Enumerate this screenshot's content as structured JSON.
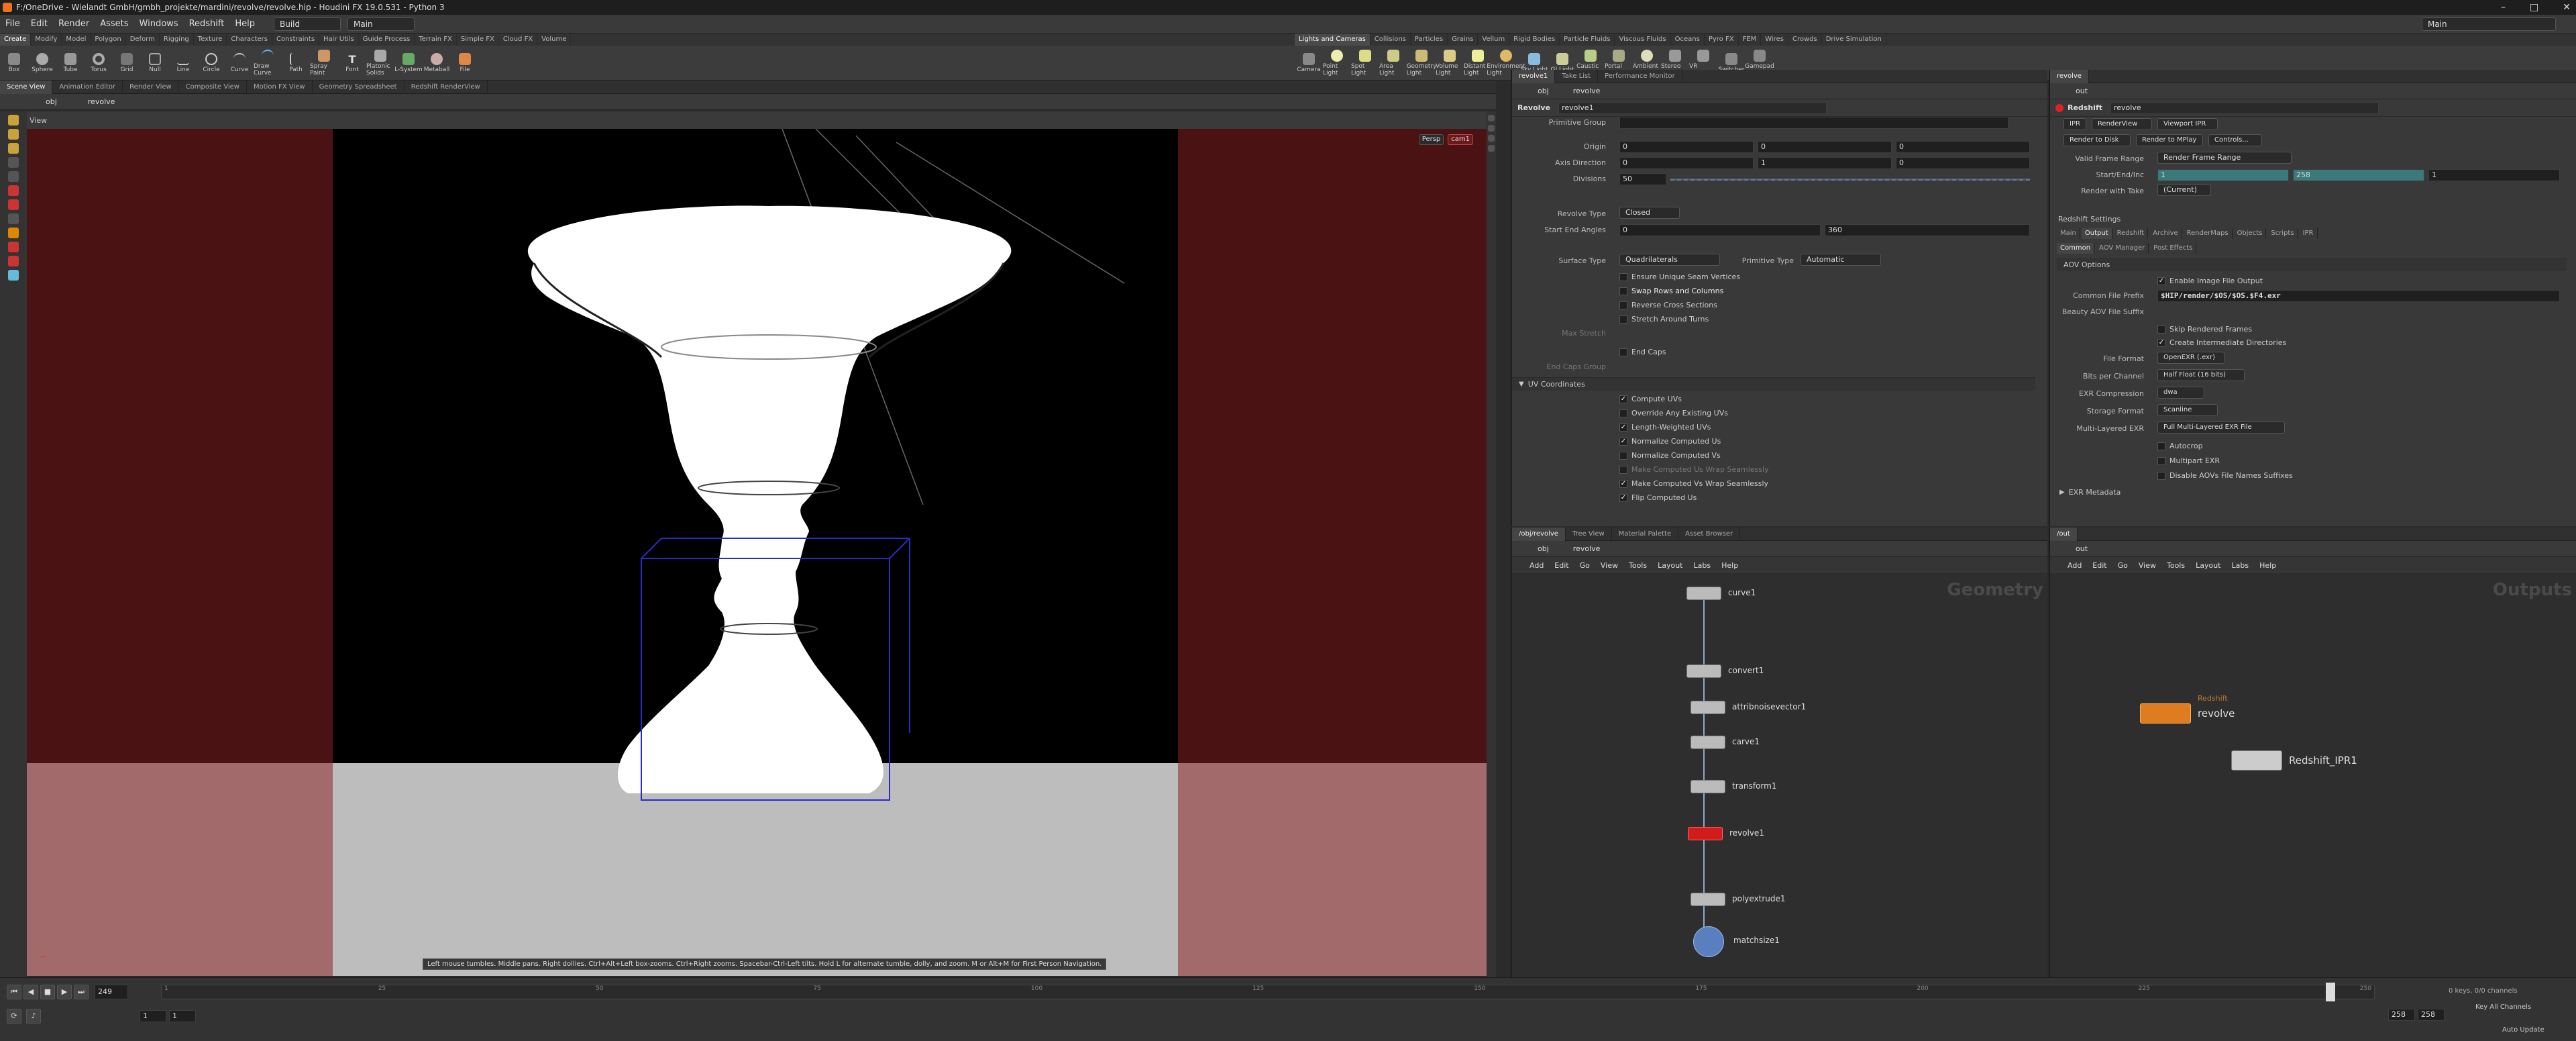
{
  "window": {
    "title": "F:/OneDrive - Wielandt GmbH/gmbh_projekte/mardini/revolve/revolve.hip - Houdini FX 19.0.531 - Python 3",
    "controls": [
      "–",
      "□",
      "✕"
    ]
  },
  "menubar": {
    "items": [
      "File",
      "Edit",
      "Render",
      "Assets",
      "Windows",
      "Redshift",
      "Help"
    ],
    "build_label": "Build",
    "main_label": "Main",
    "desktop_label": "Main"
  },
  "shelf_left": {
    "tabs": [
      "Create",
      "Modify",
      "Model",
      "Polygon",
      "Deform",
      "Rigging",
      "Texture",
      "Characters",
      "Constraints",
      "Hair Utils",
      "Guide Process",
      "Terrain FX",
      "Simple FX",
      "Cloud FX",
      "Volume"
    ],
    "tools": [
      "Box",
      "Sphere",
      "Tube",
      "Torus",
      "Grid",
      "Null",
      "Line",
      "Circle",
      "Curve",
      "Draw Curve",
      "Path",
      "Spray Paint",
      "Font",
      "Platonic Solids",
      "L-System",
      "Metaball",
      "File"
    ]
  },
  "shelf_right": {
    "tabs": [
      "Lights and Cameras",
      "Collisions",
      "Particles",
      "Grains",
      "Vellum",
      "Rigid Bodies",
      "Particle Fluids",
      "Viscous Fluids",
      "Oceans",
      "Pyro FX",
      "FEM",
      "Wires",
      "Crowds",
      "Drive Simulation"
    ],
    "tools": [
      "Camera",
      "Point Light",
      "Spot Light",
      "Area Light",
      "Geometry Light",
      "Volume Light",
      "Distant Light",
      "Environment Light",
      "Sky Light",
      "GI Light",
      "Caustic Light",
      "Portal Light",
      "Ambient Light",
      "Stereo Camera",
      "VR Camera",
      "Switcher",
      "Gamepad Camera"
    ]
  },
  "viewer_tabs": [
    "Scene View",
    "Animation Editor",
    "Render View",
    "Composite View",
    "Motion FX View",
    "Geometry Spreadsheet",
    "Redshift RenderView"
  ],
  "viewer_path": [
    "obj",
    "revolve"
  ],
  "viewport": {
    "label": "View",
    "persp": "Persp",
    "camera": "cam1",
    "hint": "Left mouse tumbles. Middle pans. Right dollies. Ctrl+Alt+Left box-zooms. Ctrl+Right zooms. Spacebar-Ctrl-Left tilts. Hold L for alternate tumble, dolly, and zoom.    M or Alt+M for First Person Navigation."
  },
  "params_tabs": [
    "revolve1",
    "Take List",
    "Performance Monitor"
  ],
  "params_path": [
    "obj",
    "revolve"
  ],
  "params": {
    "node_type": "Revolve",
    "node_name": "revolve1",
    "primitive_group_label": "Primitive Group",
    "origin_label": "Origin",
    "origin": [
      "0",
      "0",
      "0"
    ],
    "axis_label": "Axis Direction",
    "axis": [
      "0",
      "1",
      "0"
    ],
    "divisions_label": "Divisions",
    "divisions": "50",
    "revolve_type_label": "Revolve Type",
    "revolve_type": "Closed",
    "angles_label": "Start End Angles",
    "angles": [
      "0",
      "360"
    ],
    "surface_type_label": "Surface Type",
    "surface_type": "Quadrilaterals",
    "primitive_type_label": "Primitive Type",
    "primitive_type": "Automatic",
    "checks": [
      {
        "label": "Ensure Unique Seam Vertices",
        "checked": false
      },
      {
        "label": "Swap Rows and Columns",
        "checked": false
      },
      {
        "label": "Reverse Cross Sections",
        "checked": false
      },
      {
        "label": "Stretch Around Turns",
        "checked": false
      }
    ],
    "max_stretch_label": "Max Stretch",
    "end_caps_label": "End Caps",
    "end_caps_group_label": "End Caps Group",
    "uv_section": "UV Coordinates",
    "uv_checks": [
      {
        "label": "Compute UVs",
        "checked": true
      },
      {
        "label": "Override Any Existing UVs",
        "checked": false
      },
      {
        "label": "Length-Weighted UVs",
        "checked": true
      },
      {
        "label": "Normalize Computed Us",
        "checked": true
      },
      {
        "label": "Normalize Computed Vs",
        "checked": false
      },
      {
        "label": "Make Computed Us Wrap Seamlessly",
        "checked": false
      },
      {
        "label": "Make Computed Vs Wrap Seamlessly",
        "checked": true
      },
      {
        "label": "Flip Computed Us",
        "checked": true
      }
    ]
  },
  "rs_tabs": [
    "revolve"
  ],
  "rs_path": [
    "out"
  ],
  "redshift": {
    "node_type": "Redshift",
    "node_name": "revolve",
    "buttons_row1": [
      "IPR",
      "RenderView",
      "Viewport IPR"
    ],
    "buttons_row2": [
      "Render to Disk",
      "Render to MPlay",
      "Controls..."
    ],
    "valid_frame_label": "Valid Frame Range",
    "valid_frame": "Render Frame Range",
    "start_end_label": "Start/End/Inc",
    "start_end": [
      "1",
      "258",
      "1"
    ],
    "take_label": "Render with Take",
    "take": "(Current)",
    "settings_label": "Redshift Settings",
    "tabs1": [
      "Main",
      "Output",
      "Redshift",
      "Archive",
      "RenderMaps",
      "Objects",
      "Scripts",
      "IPR"
    ],
    "tabs2": [
      "Common",
      "AOV Manager",
      "Post Effects"
    ],
    "aov_options": "AOV Options",
    "enable_output": "Enable Image File Output",
    "common_prefix_label": "Common File Prefix",
    "common_prefix": "$HIP/render/$OS/$OS.$F4.exr",
    "beauty_suffix_label": "Beauty AOV File Suffix",
    "skip_rendered": "Skip Rendered Frames",
    "create_dirs": "Create Intermediate Directories",
    "file_format_label": "File Format",
    "file_format": "OpenEXR (.exr)",
    "bits_label": "Bits per Channel",
    "bits": "Half Float (16 bits)",
    "exr_comp_label": "EXR Compression",
    "exr_comp": "dwa",
    "storage_label": "Storage Format",
    "storage": "Scanline",
    "multilayer_label": "Multi-Layered EXR",
    "multilayer": "Full Multi-Layered EXR File",
    "autocrop": "Autocrop",
    "multipart": "Multipart EXR",
    "disable_suffix": "Disable AOVs File Names Suffixes",
    "exr_meta": "EXR Metadata"
  },
  "net_left": {
    "tabs": [
      "/obj/revolve",
      "Tree View",
      "Material Palette",
      "Asset Browser"
    ],
    "path": [
      "obj",
      "revolve"
    ],
    "menu": [
      "Add",
      "Edit",
      "Go",
      "View",
      "Tools",
      "Layout",
      "Labs",
      "Help"
    ],
    "watermark": "Geometry",
    "nodes": [
      "curve1",
      "convert1",
      "attribnoisevector1",
      "carve1",
      "transform1",
      "revolve1",
      "polyextrude1",
      "matchsize1"
    ]
  },
  "net_right": {
    "tabs": [
      "/out"
    ],
    "path": [
      "out"
    ],
    "menu": [
      "Add",
      "Edit",
      "Go",
      "View",
      "Tools",
      "Layout",
      "Labs",
      "Help"
    ],
    "watermark": "Outputs",
    "node1_type": "Redshift",
    "node1_name": "revolve",
    "node2_name": "Redshift_IPR1"
  },
  "timeline": {
    "frame": "249",
    "ticks": [
      "1",
      "25",
      "50",
      "75",
      "100",
      "125",
      "150",
      "175",
      "200",
      "225",
      "250"
    ],
    "start": "1",
    "start2": "1",
    "end": "258",
    "end2": "258",
    "keys": "0 keys, 0/0 channels",
    "key_all": "Key All Channels",
    "auto_update": "Auto Update"
  }
}
